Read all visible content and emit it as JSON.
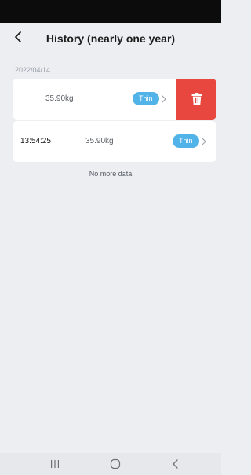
{
  "header": {
    "title": "History (nearly one year)",
    "back_icon": "chevron-left-icon"
  },
  "history": {
    "date": "2022/04/14",
    "records": [
      {
        "time": "",
        "weight": "35.90kg",
        "status": "Thin",
        "swiped": true
      },
      {
        "time": "13:54:25",
        "weight": "35.90kg",
        "status": "Thin",
        "swiped": false
      }
    ],
    "footer": "No more data"
  },
  "delete_action": {
    "icon": "trash-icon",
    "color": "#e8473f"
  },
  "colors": {
    "background": "#eceef2",
    "badge": "#52b3e8",
    "delete": "#e8473f",
    "status_bar": "#0c0c0c"
  },
  "system_nav": {
    "recent_icon": "recent-apps-icon",
    "home_icon": "home-icon",
    "back_icon": "back-icon"
  }
}
